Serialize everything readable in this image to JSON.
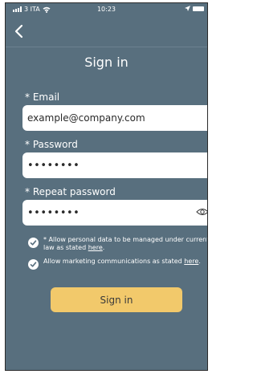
{
  "status_bar": {
    "carrier": "3 ITA",
    "time": "10:23"
  },
  "header": {
    "back_icon": "chevron-left-icon",
    "title": "Sign in"
  },
  "form": {
    "email": {
      "label": "* Email",
      "value": "example@company.com"
    },
    "password": {
      "label": "* Password",
      "value": "••••••••"
    },
    "repeat_password": {
      "label": "* Repeat password",
      "value": "••••••••"
    }
  },
  "consents": [
    {
      "text": "* Allow personal data to be managed under current law as stated ",
      "link": "here",
      "suffix": ".",
      "checked": true
    },
    {
      "text": "Allow marketing communications as stated ",
      "link": "here",
      "suffix": ".",
      "checked": true
    }
  ],
  "submit_label": "Sign in",
  "colors": {
    "background": "#586f7e",
    "accent": "#f2c96b",
    "field": "#ffffff"
  }
}
